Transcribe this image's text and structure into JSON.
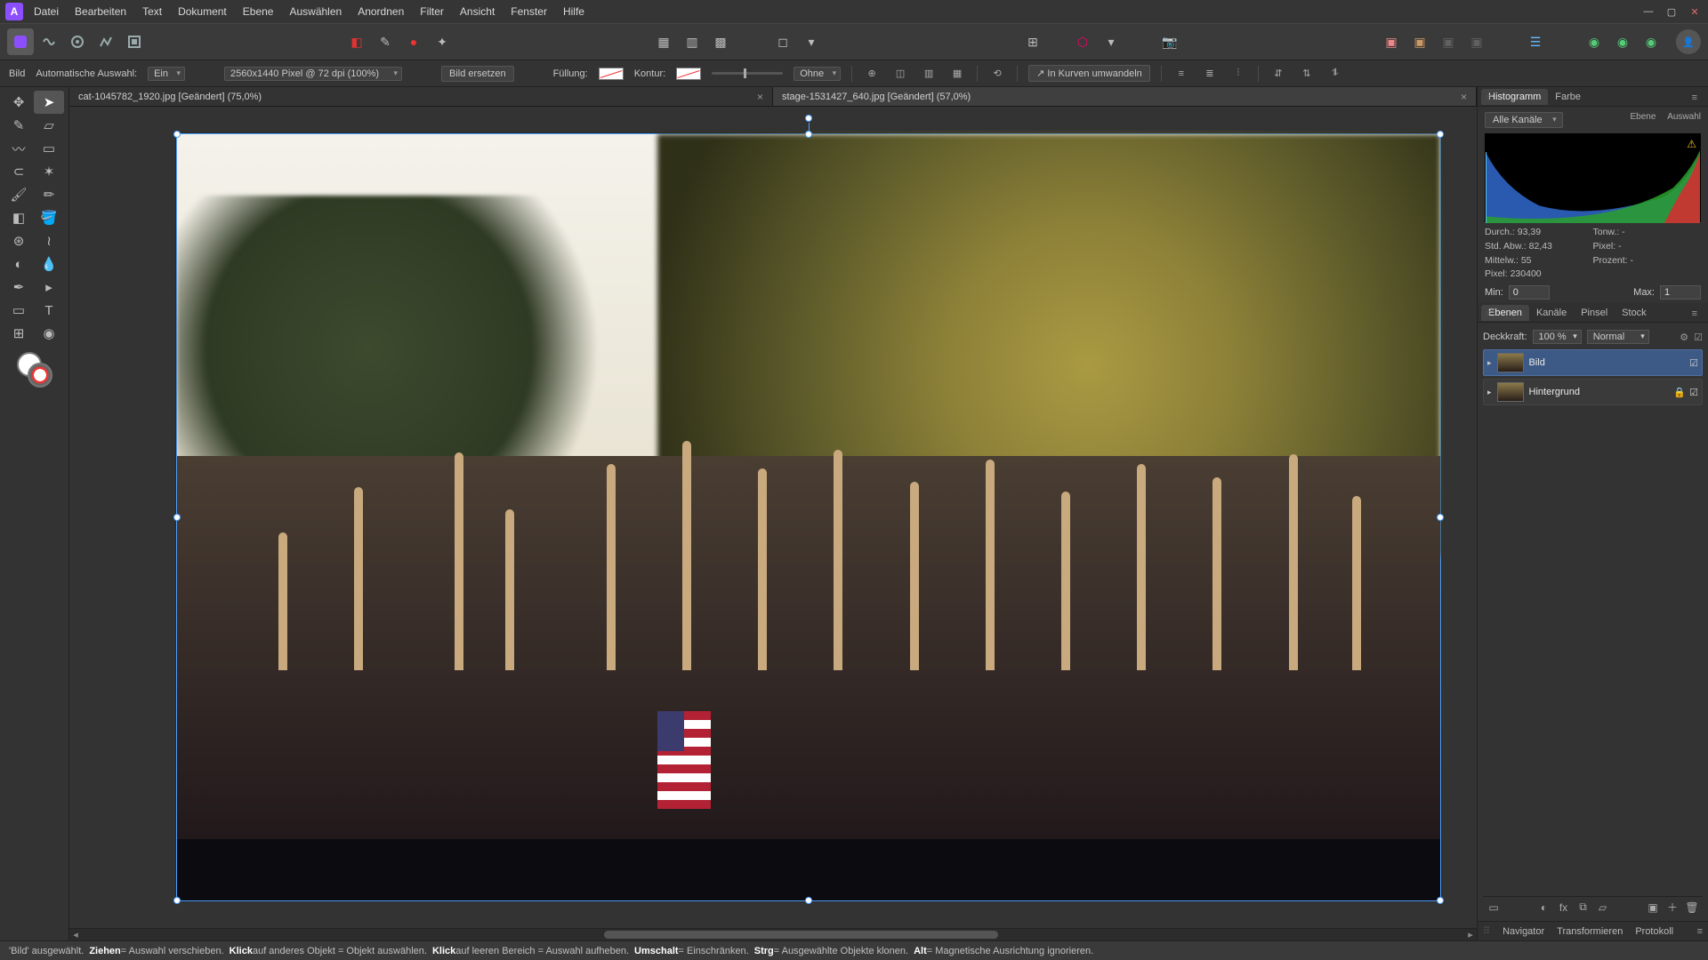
{
  "menu": {
    "items": [
      "Datei",
      "Bearbeiten",
      "Text",
      "Dokument",
      "Ebene",
      "Auswählen",
      "Anordnen",
      "Filter",
      "Ansicht",
      "Fenster",
      "Hilfe"
    ]
  },
  "context": {
    "tool_label": "Bild",
    "auto_select_label": "Automatische Auswahl:",
    "auto_select_value": "Ein",
    "dims": "2560x1440 Pixel @ 72 dpi (100%)",
    "replace_btn": "Bild ersetzen",
    "fill_label": "Füllung:",
    "stroke_label": "Kontur:",
    "stroke_style": "Ohne",
    "convert_btn": "In Kurven umwandeln"
  },
  "tabs": [
    {
      "title": "cat-1045782_1920.jpg [Geändert] (75,0%)",
      "active": false
    },
    {
      "title": "stage-1531427_640.jpg [Geändert] (57,0%)",
      "active": true
    }
  ],
  "hist": {
    "tabs": [
      "Histogramm",
      "Farbe"
    ],
    "channel": "Alle Kanäle",
    "chips": [
      "Ebene",
      "Auswahl"
    ],
    "stats": {
      "durch": "Durch.: 93,39",
      "tonw": "Tonw.: -",
      "stdabw": "Std. Abw.: 82,43",
      "pixelr": "Pixel: -",
      "mittelw": "Mittelw.: 55",
      "prozent": "Prozent: -",
      "pixel": "Pixel: 230400"
    },
    "min_label": "Min:",
    "min_val": "0",
    "max_label": "Max:",
    "max_val": "1"
  },
  "layers": {
    "tabs": [
      "Ebenen",
      "Kanäle",
      "Pinsel",
      "Stock"
    ],
    "opacity_label": "Deckkraft:",
    "opacity_val": "100 %",
    "blend": "Normal",
    "items": [
      {
        "name": "Bild",
        "selected": true,
        "locked": false
      },
      {
        "name": "Hintergrund",
        "selected": false,
        "locked": true
      }
    ]
  },
  "bottom_tabs": [
    "Navigator",
    "Transformieren",
    "Protokoll"
  ],
  "status": {
    "s1a": "'Bild' ausgewählt. ",
    "s1b": "Ziehen",
    "s1c": " = Auswahl verschieben. ",
    "s2b": "Klick",
    "s2c": " auf anderes Objekt = Objekt auswählen. ",
    "s3b": "Klick",
    "s3c": " auf leeren Bereich = Auswahl aufheben. ",
    "s4b": "Umschalt",
    "s4c": " = Einschränken. ",
    "s5b": "Strg",
    "s5c": " = Ausgewählte Objekte klonen. ",
    "s6b": "Alt",
    "s6c": " = Magnetische Ausrichtung ignorieren."
  }
}
